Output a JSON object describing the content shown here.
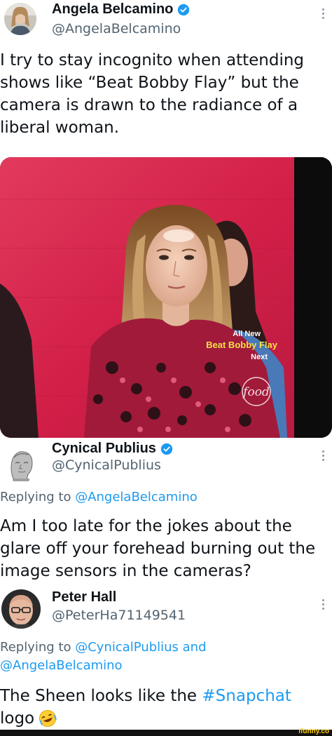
{
  "tweet1": {
    "name": "Angela Belcamino",
    "handle": "@AngelaBelcamino",
    "text_lines": [
      "I try to stay incognito when attending",
      "shows like “Beat Bobby Flay” but the",
      "camera is drawn to the radiance of a",
      "liberal woman."
    ],
    "media": {
      "overlay_line1": "All New",
      "overlay_line2": "Beat Bobby Flay",
      "overlay_line3": "Next",
      "channel_logo": "food"
    }
  },
  "tweet2": {
    "name": "Cynical Publius",
    "handle": "@CynicalPublius",
    "replying_prefix": "Replying to ",
    "replying_to": "@AngelaBelcamino",
    "text_lines": [
      "Am I too late for the jokes about the",
      "glare off your forehead burning out the",
      "image sensors in the cameras?"
    ]
  },
  "tweet3": {
    "name": "Peter Hall",
    "handle": "@PeterHa71149541",
    "replying_prefix": "Replying to ",
    "replying_to_1": "@CynicalPublius",
    "replying_and": " and",
    "replying_to_2": "@AngelaBelcamino",
    "text_line1_prefix": "The Sheen looks like the ",
    "hashtag": "#Snapchat",
    "text_line2": "logo"
  },
  "watermark": "ifunny.co",
  "colors": {
    "verified": "#1d9bf0",
    "link": "#1d9bf0",
    "secondary_text": "#536471",
    "studio_red": "#d7204a"
  }
}
